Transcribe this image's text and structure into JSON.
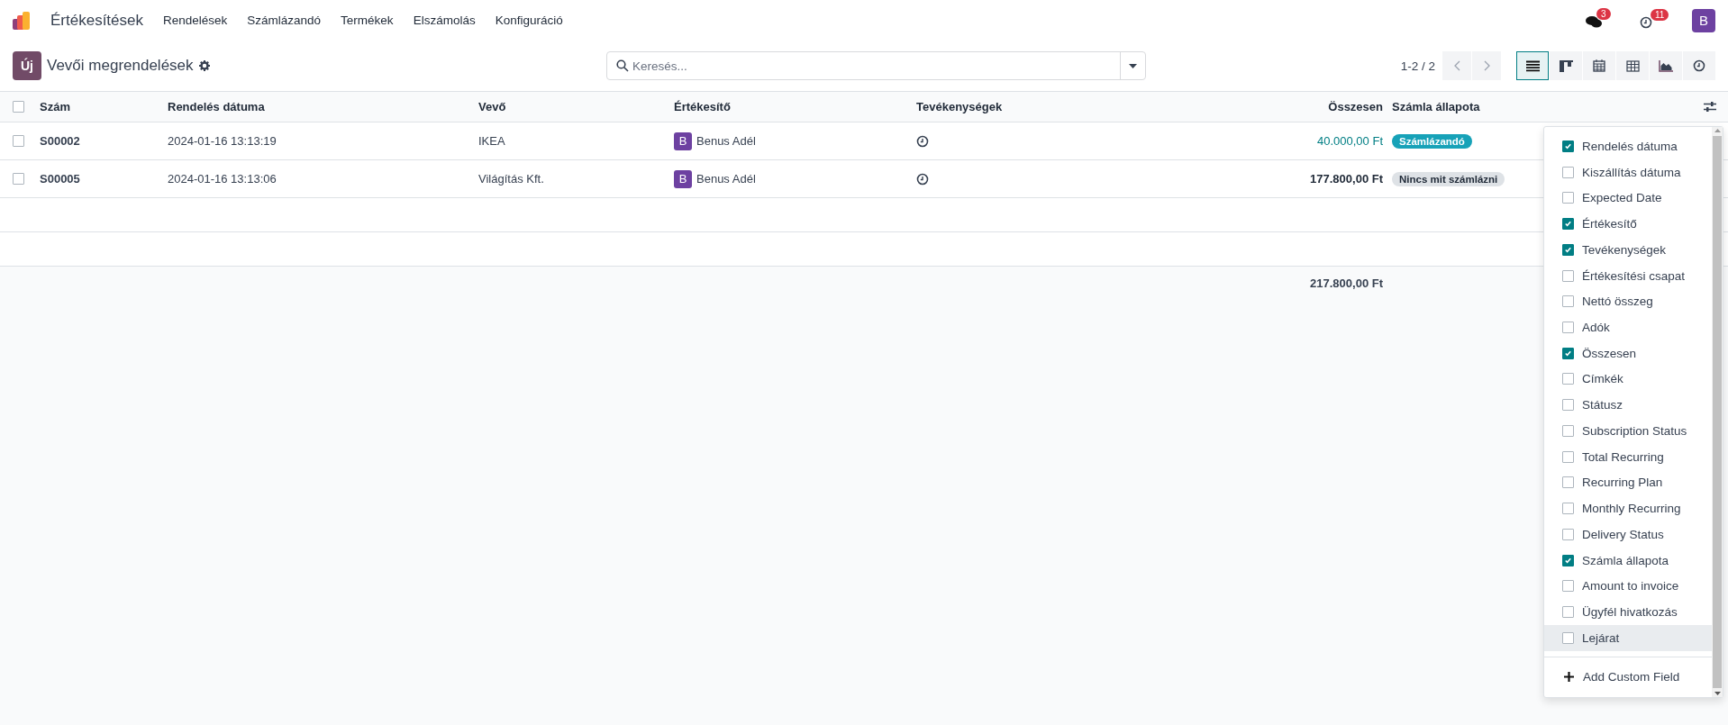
{
  "app": {
    "name": "Értékesítések",
    "menu": [
      "Rendelések",
      "Számlázandó",
      "Termékek",
      "Elszámolás",
      "Konfiguráció"
    ]
  },
  "systray": {
    "messages": "3",
    "activities": "11",
    "avatar": "B"
  },
  "control": {
    "new_button": "Új",
    "title": "Vevői megrendelések",
    "search": {
      "placeholder": "Keresés..."
    },
    "pager": "1-2 / 2",
    "views": [
      {
        "kind": "list",
        "selected": true
      },
      {
        "kind": "kanban",
        "selected": false
      },
      {
        "kind": "calendar",
        "selected": false
      },
      {
        "kind": "pivot",
        "selected": false
      },
      {
        "kind": "graph",
        "selected": false
      },
      {
        "kind": "activity",
        "selected": false
      }
    ]
  },
  "table": {
    "all_selected": false,
    "columns": [
      "Szám",
      "Rendelés dátuma",
      "Vevő",
      "Értékesítő",
      "Tevékenységek",
      "Összesen",
      "Számla állapota"
    ],
    "rows": [
      {
        "selected": false,
        "number": "S00002",
        "date": "2024-01-16 13:13:19",
        "customer": "IKEA",
        "salesperson": {
          "initial": "B",
          "name": "Benus Adél"
        },
        "total": "40.000,00 Ft",
        "total_highlight": true,
        "status": {
          "label": "Számlázandó",
          "color": "#17a2b8"
        }
      },
      {
        "selected": false,
        "number": "S00005",
        "date": "2024-01-16 13:13:06",
        "customer": "Világítás Kft.",
        "salesperson": {
          "initial": "B",
          "name": "Benus Adél"
        },
        "total": "177.800,00 Ft",
        "total_highlight": false,
        "status": {
          "label": "Nincs mit számlázni",
          "color": "#dee2e6"
        }
      }
    ],
    "sum": "217.800,00 Ft"
  },
  "field_menu": {
    "items": [
      {
        "label": "Rendelés dátuma",
        "checked": true,
        "hovered": false
      },
      {
        "label": "Kiszállítás dátuma",
        "checked": false,
        "hovered": false
      },
      {
        "label": "Expected Date",
        "checked": false,
        "hovered": false
      },
      {
        "label": "Értékesítő",
        "checked": true,
        "hovered": false
      },
      {
        "label": "Tevékenységek",
        "checked": true,
        "hovered": false
      },
      {
        "label": "Értékesítési csapat",
        "checked": false,
        "hovered": false
      },
      {
        "label": "Nettó összeg",
        "checked": false,
        "hovered": false
      },
      {
        "label": "Adók",
        "checked": false,
        "hovered": false
      },
      {
        "label": "Összesen",
        "checked": true,
        "hovered": false
      },
      {
        "label": "Címkék",
        "checked": false,
        "hovered": false
      },
      {
        "label": "Státusz",
        "checked": false,
        "hovered": false
      },
      {
        "label": "Subscription Status",
        "checked": false,
        "hovered": false
      },
      {
        "label": "Total Recurring",
        "checked": false,
        "hovered": false
      },
      {
        "label": "Recurring Plan",
        "checked": false,
        "hovered": false
      },
      {
        "label": "Monthly Recurring",
        "checked": false,
        "hovered": false
      },
      {
        "label": "Delivery Status",
        "checked": false,
        "hovered": false
      },
      {
        "label": "Számla állapota",
        "checked": true,
        "hovered": false
      },
      {
        "label": "Amount to invoice",
        "checked": false,
        "hovered": false
      },
      {
        "label": "Ügyfél hivatkozás",
        "checked": false,
        "hovered": false
      },
      {
        "label": "Lejárat",
        "checked": false,
        "hovered": true
      }
    ],
    "add_custom": "Add Custom Field"
  }
}
